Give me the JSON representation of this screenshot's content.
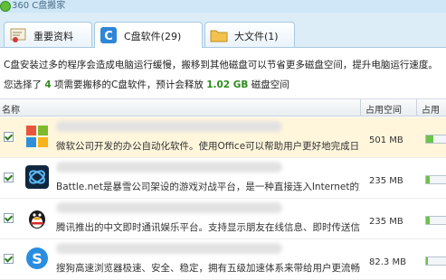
{
  "app": {
    "title": "360 C盘搬家"
  },
  "tabs": [
    {
      "label": "重要资料",
      "active": false
    },
    {
      "label": "C盘软件(29)",
      "active": true
    },
    {
      "label": "大文件(1)",
      "active": false
    }
  ],
  "info": {
    "line1": "C盘安装过多的程序会造成电脑运行缓慢，搬移到其他磁盘可以节省更多磁盘空间，提升电脑运行速度。",
    "line2_prefix": "您选择了",
    "selected_count": "4",
    "line2_mid": "项需要搬移的C盘软件，预计会释放",
    "release_size": "1.02 GB",
    "line2_suffix": "磁盘空间"
  },
  "columns": {
    "name": "名称",
    "space": "占用空间",
    "space2": "占用空间"
  },
  "rows": [
    {
      "desc": "微软公司开发的办公自动化软件。使用Office可以帮助用户更好地完成日...",
      "size": "501 MB",
      "usage": 0.35,
      "icon": "office-icon",
      "selected": true,
      "checked": true
    },
    {
      "desc": "Battle.net是暴雪公司架设的游戏对战平台，是一种直接连入Internet的方...",
      "size": "235 MB",
      "usage": 0.17,
      "icon": "battlenet-icon",
      "selected": false,
      "checked": true
    },
    {
      "desc": "腾讯推出的中文即时通讯娱乐平台。支持显示朋友在线信息、即时传送信...",
      "size": "235 MB",
      "usage": 0.17,
      "icon": "qq-icon",
      "selected": false,
      "checked": true
    },
    {
      "desc": "搜狗高速浏览器极速、安全、稳定，拥有五级加速体系来带给用户更流畅...",
      "size": "82.3 MB",
      "usage": 0.07,
      "icon": "sogou-browser-icon",
      "selected": false,
      "checked": true
    }
  ],
  "colors": {
    "accent_green": "#2e8b1f",
    "bar_green": "#6cc24a",
    "selected_row": "#fff6dc"
  }
}
